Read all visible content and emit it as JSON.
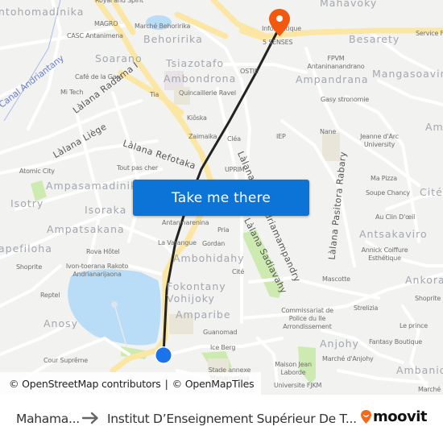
{
  "map": {
    "action_button": "Take me there",
    "attribution": {
      "osm": "© OpenStreetMap contributors",
      "separator": "|",
      "omt": "© OpenMapTiles"
    },
    "colors": {
      "background": "#f2f2f1",
      "major_road": "#fbe7a3",
      "water": "#b9dcf7",
      "park": "#cdeab0",
      "route_line": "#222222",
      "destination_pin": "#f3580f",
      "origin_dot": "#1a73e8",
      "button": "#0b74d6"
    },
    "area_labels": [
      "ntohomadinika",
      "Behoririka",
      "Soarano",
      "Tsiazotafo",
      "Ambondrona",
      "Mahavoky",
      "Besarety",
      "Ampandrana",
      "Mangasoavina",
      "Ampasamadinika",
      "Isotry",
      "Isoraka",
      "Ampatsakana",
      "apefiloha",
      "Ambohidahy",
      "Fokontany Vohijoky",
      "Amparibe",
      "Anosy",
      "Antsakaviro",
      "Ankora",
      "Cité",
      "Anjohy",
      "Ambanid",
      "Am"
    ],
    "poi_labels": [
      "Royal and Spirit",
      "MAGRO",
      "Marché Behoririka",
      "CASC Antanimena",
      "Café de la Gare",
      "Mi Tech",
      "Tia",
      "Quincaillerie Ravel",
      "OSTIE",
      "Kiôska",
      "Zaimaika",
      "Cléa",
      "IEP",
      "Nane",
      "Jeanne d'Arc University",
      "UPRIM",
      "Atomic City",
      "Tout pas cher",
      "Antaninarenina",
      "Pria",
      "La Varangue",
      "Gordan",
      "Rova Hôtel",
      "Ivon-toerana Rakoto Andrianarijaona",
      "Shoprite",
      "Reptel",
      "Cité",
      "Guanomad",
      "Ice Berg",
      "Stade annexe Mahamasina",
      "Cour Suprême",
      "Mascotte",
      "Strelizia",
      "Commissariat de Police du IIe Arrondissement",
      "Maison Jean Laborde",
      "Universite FJKM",
      "Marché d'Anjohy",
      "Fantasy Boutique",
      "Le prince",
      "Shoprite",
      "Ma Pizza",
      "Soupe Chancy",
      "Au Clin D'œil",
      "Annick Coiffure Esthétique",
      "FPVM Antaninanandrano",
      "Gasy stronomie",
      "Service F",
      "5 SENSES",
      "Informatique",
      "Marché"
    ],
    "street_labels": [
      "Làlana Radama I",
      "Làlana Liège",
      "Làlana Refotaka",
      "Làlana Rainandriamampandry",
      "Làlana Sadiavahy",
      "Làlana Pasitora Rabary"
    ],
    "water_labels": [
      "Canal Andriantany"
    ]
  },
  "footer": {
    "origin": "Mahama...",
    "destination": "Institut D’Enseignement Supérieur De T...",
    "brand": "moovit",
    "brand_color": "#f26b1d"
  }
}
